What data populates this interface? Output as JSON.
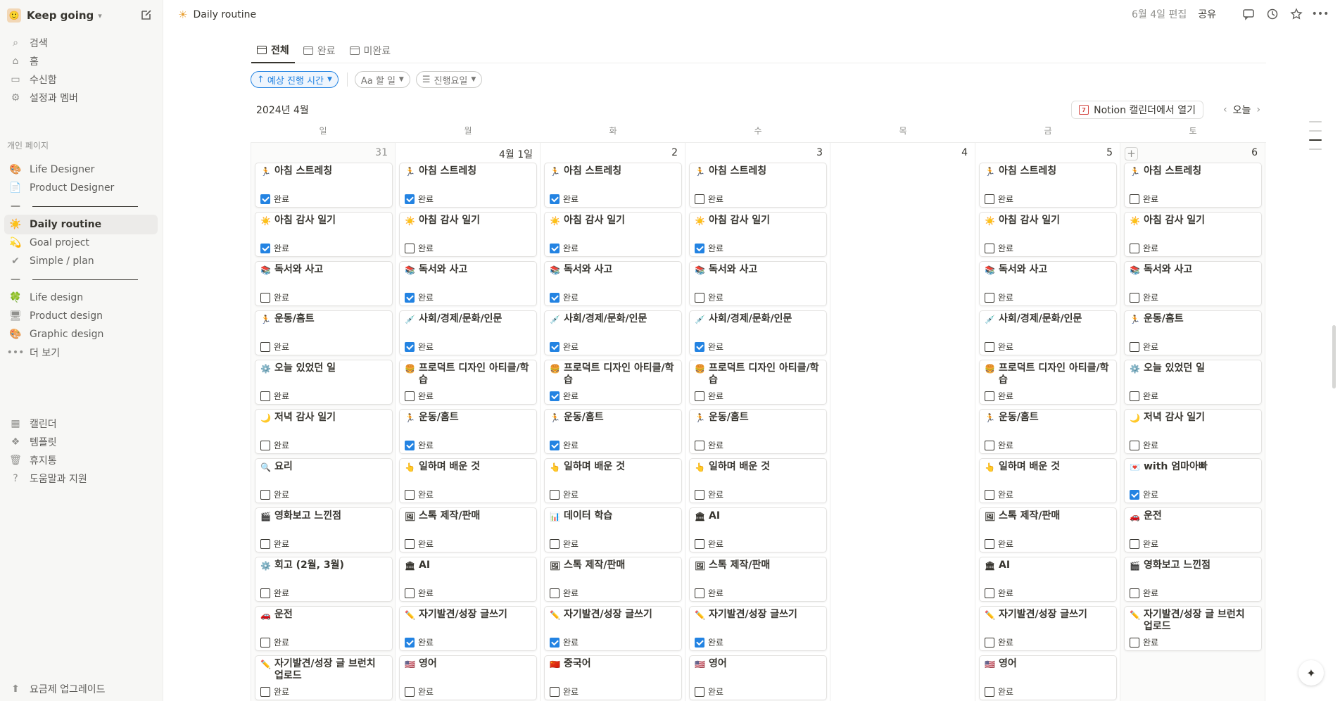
{
  "sidebar": {
    "workspace": "Keep going",
    "nav": [
      {
        "label": "검색",
        "icon": "search-icon"
      },
      {
        "label": "홈",
        "icon": "home-icon"
      },
      {
        "label": "수신함",
        "icon": "inbox-icon"
      },
      {
        "label": "설정과 멤버",
        "icon": "gear-icon"
      }
    ],
    "section_label": "개인 페이지",
    "pages": [
      {
        "label": "Life Designer",
        "icon": "🎨"
      },
      {
        "label": "Product Designer",
        "icon": "📄"
      },
      {
        "label": "",
        "divider": true
      },
      {
        "label": "Daily routine",
        "icon": "☀️"
      },
      {
        "label": "Goal project",
        "icon": "💫"
      },
      {
        "label": "Simple / plan",
        "icon": "✔"
      },
      {
        "label": "",
        "divider": true
      },
      {
        "label": "Life design",
        "icon": "🍀"
      },
      {
        "label": "Product design",
        "icon": "🖥"
      },
      {
        "label": "Graphic design",
        "icon": "🎨"
      },
      {
        "label": "더 보기",
        "icon": "•••"
      }
    ],
    "bottom": [
      {
        "label": "캘린더",
        "icon": "calendar-icon"
      },
      {
        "label": "템플릿",
        "icon": "templates-icon"
      },
      {
        "label": "휴지통",
        "icon": "trash-icon"
      },
      {
        "label": "도움말과 지원",
        "icon": "help-icon"
      }
    ],
    "upgrade": "요금제 업그레이드"
  },
  "topbar": {
    "breadcrumb": "Daily routine",
    "edited": "6월 4일 편집",
    "share": "공유"
  },
  "tabs": [
    "전체",
    "완료",
    "미완료"
  ],
  "filters": {
    "sort": "예상 진행 시간",
    "f1": "Aa 할 일",
    "f2": "진행요일"
  },
  "calendar": {
    "month": "2024년 4월",
    "open_in": "Notion 캘린더에서 열기",
    "today": "오늘",
    "weekdays": [
      "일",
      "월",
      "화",
      "수",
      "목",
      "금",
      "토"
    ],
    "check_label": "완료",
    "days": [
      {
        "date": "31",
        "muted": true,
        "tasks": [
          {
            "e": "🏃",
            "t": "아침 스트레칭",
            "c": true
          },
          {
            "e": "☀️",
            "t": "아침 감사 일기",
            "c": true
          },
          {
            "e": "📚",
            "t": "독서와 사고",
            "c": false
          },
          {
            "e": "🏃",
            "t": "운동/홈트",
            "c": false
          },
          {
            "e": "⚙️",
            "t": "오늘 있었던 일",
            "c": false
          },
          {
            "e": "🌙",
            "t": "저녁 감사 일기",
            "c": false
          },
          {
            "e": "🔍",
            "t": "요리",
            "c": false
          },
          {
            "e": "🎬",
            "t": "영화보고 느낀점",
            "c": false
          },
          {
            "e": "⚙️",
            "t": "회고 (2월, 3월)",
            "c": false
          },
          {
            "e": "🚗",
            "t": "운전",
            "c": false
          },
          {
            "e": "✏️",
            "t": "자기발견/성장 글 브런치 업로드",
            "c": false
          }
        ]
      },
      {
        "date": "4월 1일",
        "tasks": [
          {
            "e": "🏃",
            "t": "아침 스트레칭",
            "c": true
          },
          {
            "e": "☀️",
            "t": "아침 감사 일기",
            "c": false
          },
          {
            "e": "📚",
            "t": "독서와 사고",
            "c": true
          },
          {
            "e": "💉",
            "t": "사회/경제/문화/인문",
            "c": true
          },
          {
            "e": "🍔",
            "t": "프로덕트 디자인 아티클/학습",
            "c": false
          },
          {
            "e": "🏃",
            "t": "운동/홈트",
            "c": true
          },
          {
            "e": "👆",
            "t": "일하며 배운 것",
            "c": false
          },
          {
            "e": "🖼",
            "t": "스톡 제작/판매",
            "c": false
          },
          {
            "e": "🏛",
            "t": "AI",
            "c": false
          },
          {
            "e": "✏️",
            "t": "자기발견/성장 글쓰기",
            "c": true
          },
          {
            "e": "🇺🇸",
            "t": "영어",
            "c": false
          }
        ]
      },
      {
        "date": "2",
        "tasks": [
          {
            "e": "🏃",
            "t": "아침 스트레칭",
            "c": true
          },
          {
            "e": "☀️",
            "t": "아침 감사 일기",
            "c": true
          },
          {
            "e": "📚",
            "t": "독서와 사고",
            "c": true
          },
          {
            "e": "💉",
            "t": "사회/경제/문화/인문",
            "c": true
          },
          {
            "e": "🍔",
            "t": "프로덕트 디자인 아티클/학습",
            "c": true
          },
          {
            "e": "🏃",
            "t": "운동/홈트",
            "c": true
          },
          {
            "e": "👆",
            "t": "일하며 배운 것",
            "c": false
          },
          {
            "e": "📊",
            "t": "데이터 학습",
            "c": false
          },
          {
            "e": "🖼",
            "t": "스톡 제작/판매",
            "c": false
          },
          {
            "e": "✏️",
            "t": "자기발견/성장 글쓰기",
            "c": true
          },
          {
            "e": "🇨🇳",
            "t": "중국어",
            "c": false
          }
        ]
      },
      {
        "date": "3",
        "tasks": [
          {
            "e": "🏃",
            "t": "아침 스트레칭",
            "c": false
          },
          {
            "e": "☀️",
            "t": "아침 감사 일기",
            "c": true
          },
          {
            "e": "📚",
            "t": "독서와 사고",
            "c": false
          },
          {
            "e": "💉",
            "t": "사회/경제/문화/인문",
            "c": true
          },
          {
            "e": "🍔",
            "t": "프로덕트 디자인 아티클/학습",
            "c": false
          },
          {
            "e": "🏃",
            "t": "운동/홈트",
            "c": false
          },
          {
            "e": "👆",
            "t": "일하며 배운 것",
            "c": false
          },
          {
            "e": "🏛",
            "t": "AI",
            "c": false
          },
          {
            "e": "🖼",
            "t": "스톡 제작/판매",
            "c": false
          },
          {
            "e": "✏️",
            "t": "자기발견/성장 글쓰기",
            "c": true
          },
          {
            "e": "🇺🇸",
            "t": "영어",
            "c": false
          }
        ]
      },
      {
        "date": "4",
        "tasks": []
      },
      {
        "date": "5",
        "tasks": [
          {
            "e": "🏃",
            "t": "아침 스트레칭",
            "c": false
          },
          {
            "e": "☀️",
            "t": "아침 감사 일기",
            "c": false
          },
          {
            "e": "📚",
            "t": "독서와 사고",
            "c": false
          },
          {
            "e": "💉",
            "t": "사회/경제/문화/인문",
            "c": false
          },
          {
            "e": "🍔",
            "t": "프로덕트 디자인 아티클/학습",
            "c": false
          },
          {
            "e": "🏃",
            "t": "운동/홈트",
            "c": false
          },
          {
            "e": "👆",
            "t": "일하며 배운 것",
            "c": false
          },
          {
            "e": "🖼",
            "t": "스톡 제작/판매",
            "c": false
          },
          {
            "e": "🏛",
            "t": "AI",
            "c": false
          },
          {
            "e": "✏️",
            "t": "자기발견/성장 글쓰기",
            "c": false
          },
          {
            "e": "🇺🇸",
            "t": "영어",
            "c": false
          }
        ]
      },
      {
        "date": "6",
        "plus": true,
        "tasks": [
          {
            "e": "🏃",
            "t": "아침 스트레칭",
            "c": false
          },
          {
            "e": "☀️",
            "t": "아침 감사 일기",
            "c": false
          },
          {
            "e": "📚",
            "t": "독서와 사고",
            "c": false
          },
          {
            "e": "🏃",
            "t": "운동/홈트",
            "c": false
          },
          {
            "e": "⚙️",
            "t": "오늘 있었던 일",
            "c": false
          },
          {
            "e": "🌙",
            "t": "저녁 감사 일기",
            "c": false
          },
          {
            "e": "💌",
            "t": "with 엄마아빠",
            "c": true
          },
          {
            "e": "🚗",
            "t": "운전",
            "c": false
          },
          {
            "e": "🎬",
            "t": "영화보고 느낀점",
            "c": false
          },
          {
            "e": "✏️",
            "t": "자기발견/성장 글 브런치 업로드",
            "c": false
          }
        ]
      }
    ]
  }
}
